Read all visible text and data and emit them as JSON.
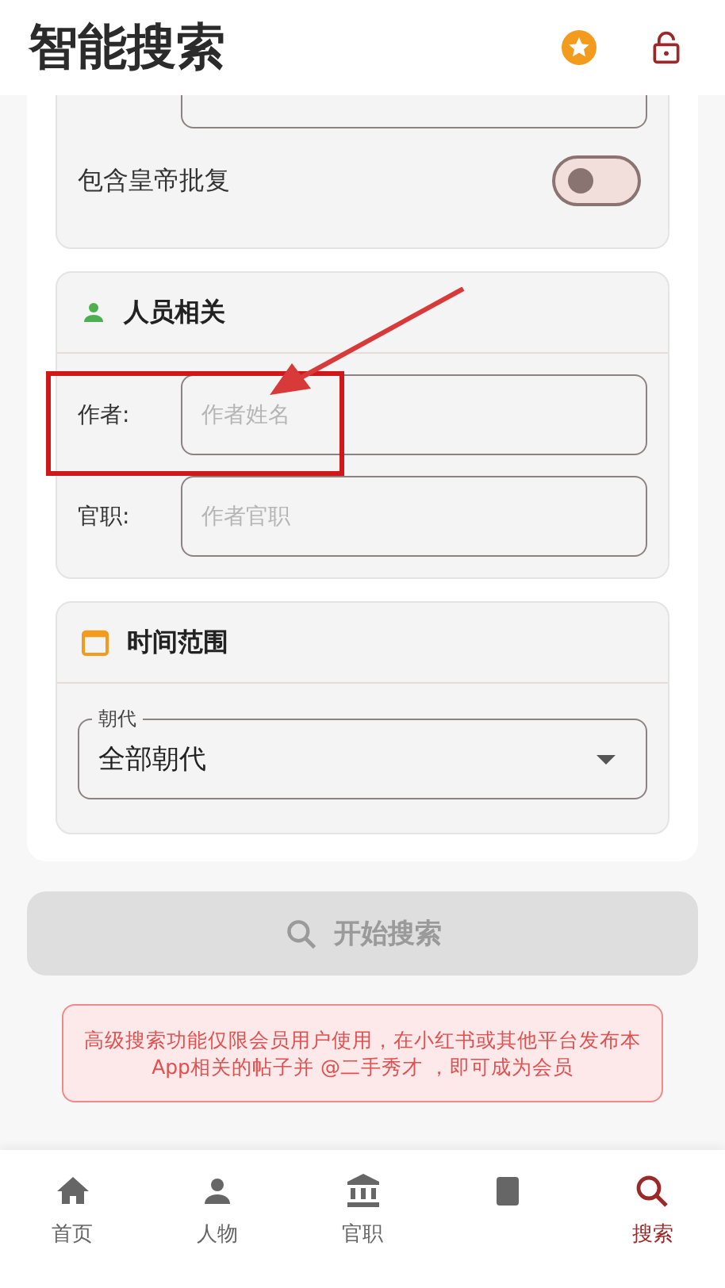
{
  "header": {
    "title": "智能搜索"
  },
  "sections": [
    {
      "kind": "toggles",
      "fields": [
        {
          "kind": "input"
        }
      ],
      "toggle": {
        "label": "包含皇帝批复",
        "on": false
      }
    },
    {
      "kind": "fields",
      "title": "人员相关",
      "fields": [
        {
          "label": "作者:",
          "placeholder": "作者姓名"
        },
        {
          "label": "官职:",
          "placeholder": "作者官职"
        }
      ]
    },
    {
      "kind": "select",
      "title": "时间范围",
      "select": {
        "label": "朝代",
        "value": "全部朝代"
      }
    }
  ],
  "search_button": {
    "label": "开始搜索",
    "disabled": true
  },
  "notice": "高级搜索功能仅限会员用户使用，在小红书或其他平台发布本App相关的帖子并 @二手秀才 ，即可成为会员",
  "annotations": [
    {
      "kind": "box"
    },
    {
      "kind": "arrow"
    }
  ],
  "nav": [
    {
      "label": "首页",
      "selected": false
    },
    {
      "label": "人物",
      "selected": false
    },
    {
      "label": "官职",
      "selected": false
    },
    {
      "selected": false
    },
    {
      "label": "搜索",
      "selected": true
    }
  ]
}
